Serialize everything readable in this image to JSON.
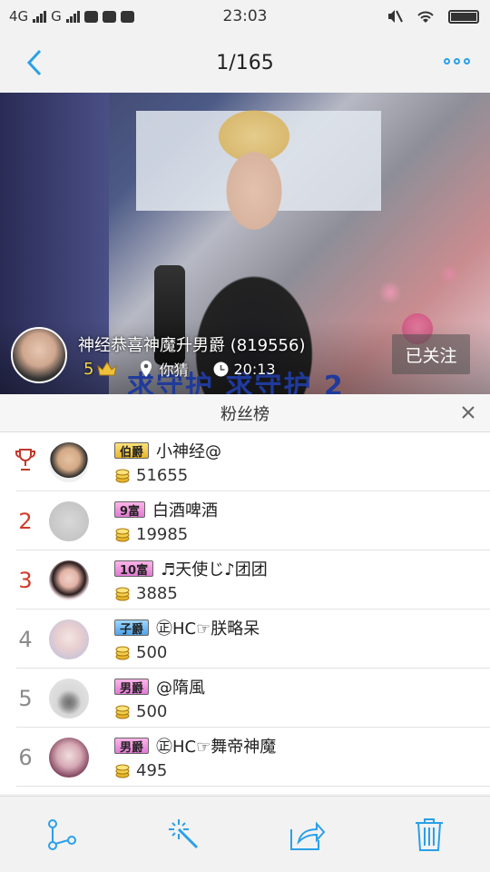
{
  "status_bar": {
    "network1": "4G",
    "network2": "G",
    "time": "23:03"
  },
  "nav": {
    "counter": "1/165"
  },
  "photo": {
    "title": "神经恭喜神魔升男爵 (819556)",
    "level": "5",
    "location": "你猜",
    "time": "20:13",
    "follow_label": "已关注",
    "banner_text": "求守护    求守护    2"
  },
  "panel": {
    "title": "粉丝榜",
    "rows": [
      {
        "rank": "",
        "badge": "伯爵",
        "name": "小神经@",
        "coins": "51655"
      },
      {
        "rank": "2",
        "badge": "9富",
        "name": "白酒啤酒",
        "coins": "19985"
      },
      {
        "rank": "3",
        "badge": "10富",
        "name": "♬天使じ♪团团",
        "coins": "3885"
      },
      {
        "rank": "4",
        "badge": "子爵",
        "name": "㊣HC☞朕略呆",
        "coins": "500"
      },
      {
        "rank": "5",
        "badge": "男爵",
        "name": "@隋風",
        "coins": "500"
      },
      {
        "rank": "6",
        "badge": "男爵",
        "name": "㊣HC☞舞帝神魔",
        "coins": "495"
      }
    ]
  },
  "colors": {
    "accent": "#2aa0e8",
    "rank_red": "#d23b2b"
  }
}
